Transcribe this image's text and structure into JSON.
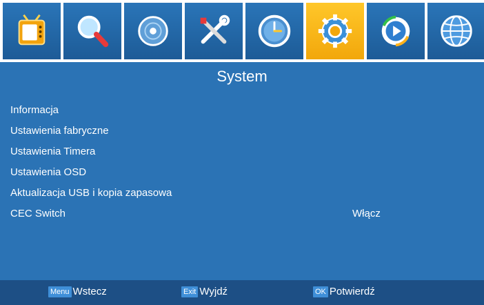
{
  "tabs": [
    {
      "icon": "tv-icon"
    },
    {
      "icon": "search-icon"
    },
    {
      "icon": "disc-icon"
    },
    {
      "icon": "tools-icon"
    },
    {
      "icon": "clock-icon"
    },
    {
      "icon": "gear-icon",
      "active": true
    },
    {
      "icon": "play-icon"
    },
    {
      "icon": "globe-icon"
    }
  ],
  "colors": {
    "panel": "#2b73b5",
    "tab": "#2a75b8",
    "active_tab": "#f5b31a",
    "bottom_bar": "#1d4f85",
    "key_badge": "#3f8fd8"
  },
  "page": {
    "title": "System"
  },
  "menu": {
    "items": [
      {
        "label": "Informacja"
      },
      {
        "label": "Ustawienia fabryczne"
      },
      {
        "label": "Ustawienia Timera"
      },
      {
        "label": "Ustawienia OSD"
      },
      {
        "label": "Aktualizacja USB i kopia zapasowa"
      },
      {
        "label": "CEC Switch",
        "value": "Włącz"
      }
    ]
  },
  "footer": {
    "back": {
      "key": "Menu",
      "label": "Wstecz"
    },
    "exit": {
      "key": "Exit",
      "label": "Wyjdź"
    },
    "ok": {
      "key": "OK",
      "label": "Potwierdź"
    }
  }
}
